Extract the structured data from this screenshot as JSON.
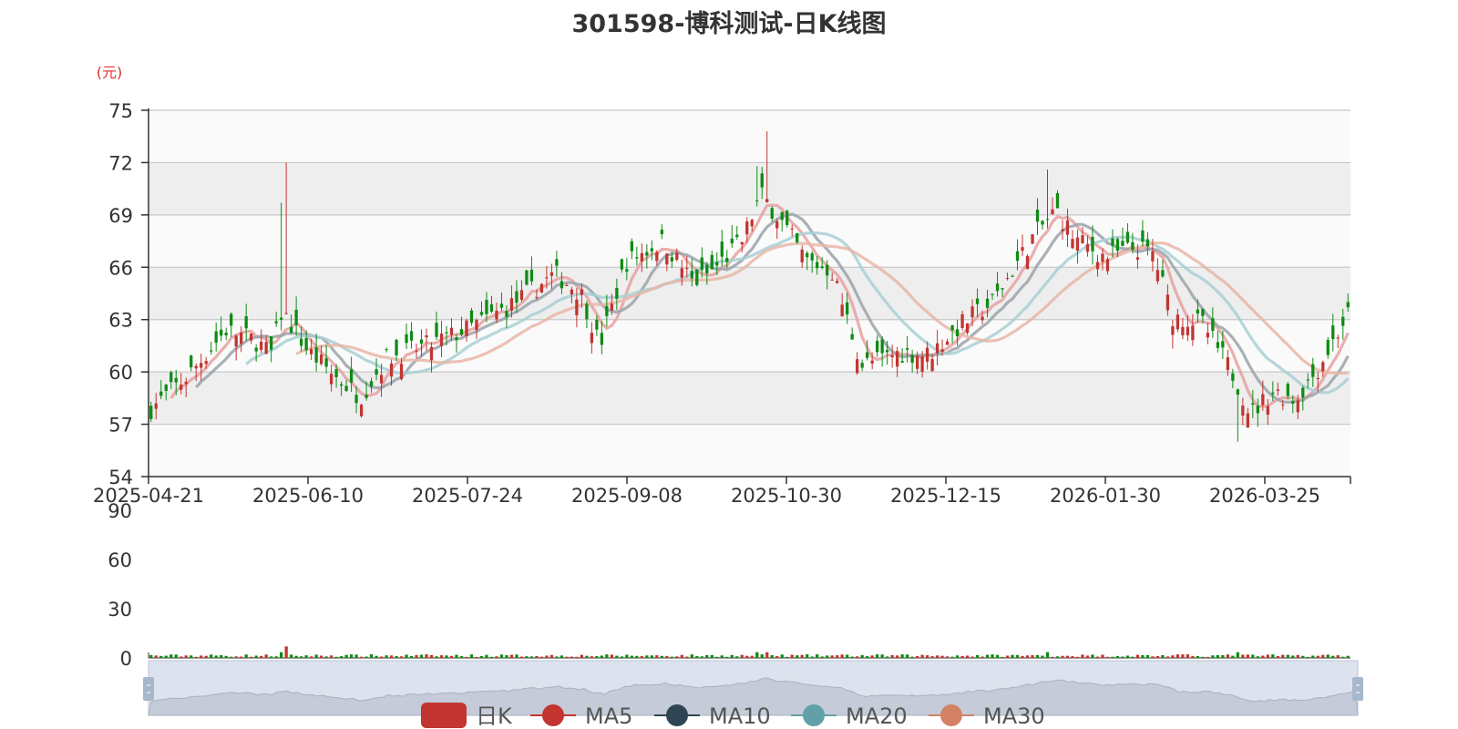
{
  "title": "301598-博科测试-日K线图",
  "chart_data": {
    "type": "candlestick",
    "title": "301598-博科测试-日K线图",
    "yunit": "(元)",
    "ylim": [
      54,
      75
    ],
    "yticks": [
      54,
      57,
      60,
      63,
      66,
      69,
      72,
      75
    ],
    "xticks": [
      "2025-04-21",
      "2025-06-10",
      "2025-07-24",
      "2025-09-08",
      "2025-10-30",
      "2025-12-15",
      "2026-01-30",
      "2026-03-25"
    ],
    "volume_ylim": [
      0,
      90
    ],
    "volume_yticks": [
      0,
      30,
      60,
      90
    ],
    "days": 240,
    "anchors": [
      {
        "i": 0,
        "p": 57.9
      },
      {
        "i": 10,
        "p": 59.8
      },
      {
        "i": 20,
        "p": 62.4
      },
      {
        "i": 28,
        "p": 61.8
      },
      {
        "i": 32,
        "p": 61.0
      },
      {
        "i": 35,
        "p": 63.5
      },
      {
        "i": 42,
        "p": 61.2
      },
      {
        "i": 50,
        "p": 59.6
      },
      {
        "i": 56,
        "p": 58.6
      },
      {
        "i": 63,
        "p": 60.8
      },
      {
        "i": 75,
        "p": 61.6
      },
      {
        "i": 85,
        "p": 62.5
      },
      {
        "i": 96,
        "p": 63.8
      },
      {
        "i": 108,
        "p": 65.6
      },
      {
        "i": 115,
        "p": 64.5
      },
      {
        "i": 120,
        "p": 61.5
      },
      {
        "i": 127,
        "p": 66.3
      },
      {
        "i": 137,
        "p": 67.5
      },
      {
        "i": 145,
        "p": 65.1
      },
      {
        "i": 150,
        "p": 65.8
      },
      {
        "i": 158,
        "p": 67.5
      },
      {
        "i": 163,
        "p": 70.2
      },
      {
        "i": 168,
        "p": 68.8
      },
      {
        "i": 175,
        "p": 66.4
      },
      {
        "i": 182,
        "p": 65.8
      },
      {
        "i": 190,
        "p": 60.4
      },
      {
        "i": 200,
        "p": 61.1
      },
      {
        "i": 208,
        "p": 61.0
      },
      {
        "i": 217,
        "p": 62.8
      },
      {
        "i": 225,
        "p": 64.0
      },
      {
        "i": 236,
        "p": 67.8
      },
      {
        "i": 242,
        "p": 69.3
      },
      {
        "i": 247,
        "p": 67.6
      },
      {
        "i": 255,
        "p": 66.6
      },
      {
        "i": 263,
        "p": 67.1
      },
      {
        "i": 268,
        "p": 66.8
      },
      {
        "i": 273,
        "p": 63.2
      },
      {
        "i": 281,
        "p": 62.8
      },
      {
        "i": 289,
        "p": 60.0
      },
      {
        "i": 294,
        "p": 57.6
      },
      {
        "i": 300,
        "p": 58.9
      },
      {
        "i": 306,
        "p": 58.4
      },
      {
        "i": 312,
        "p": 60.2
      },
      {
        "i": 320,
        "p": 63.3
      }
    ],
    "spikes": [
      {
        "i": 36,
        "high": 72.0
      },
      {
        "i": 35,
        "high": 69.7
      },
      {
        "i": 165,
        "high": 73.8
      },
      {
        "i": 162,
        "high": 71.8
      },
      {
        "i": 239,
        "high": 71.6
      },
      {
        "i": 291,
        "high": 56.0
      }
    ],
    "legend": [
      {
        "name": "日K",
        "color": "#c23531"
      },
      {
        "name": "MA5",
        "color": "#c23531"
      },
      {
        "name": "MA10",
        "color": "#2f4554"
      },
      {
        "name": "MA20",
        "color": "#61a0a8"
      },
      {
        "name": "MA30",
        "color": "#d48265"
      }
    ],
    "ma_periods": [
      5,
      10,
      20,
      30
    ],
    "colors": {
      "up": "#c23531",
      "down": "#0f8b14",
      "ma5": "#e6a0a0",
      "ma10": "#9aa3aa",
      "ma20": "#a8cfd4",
      "ma30": "#e8b6a6",
      "band": "#eeeeee",
      "band_alt": "#fafafa",
      "axis": "#333333",
      "grid": "#c8c8c8",
      "unit": "#e3312f",
      "slider_fill": "#dde3ee",
      "slider_border": "#b8c3d6",
      "slider_area": "#b0b8c6"
    }
  }
}
